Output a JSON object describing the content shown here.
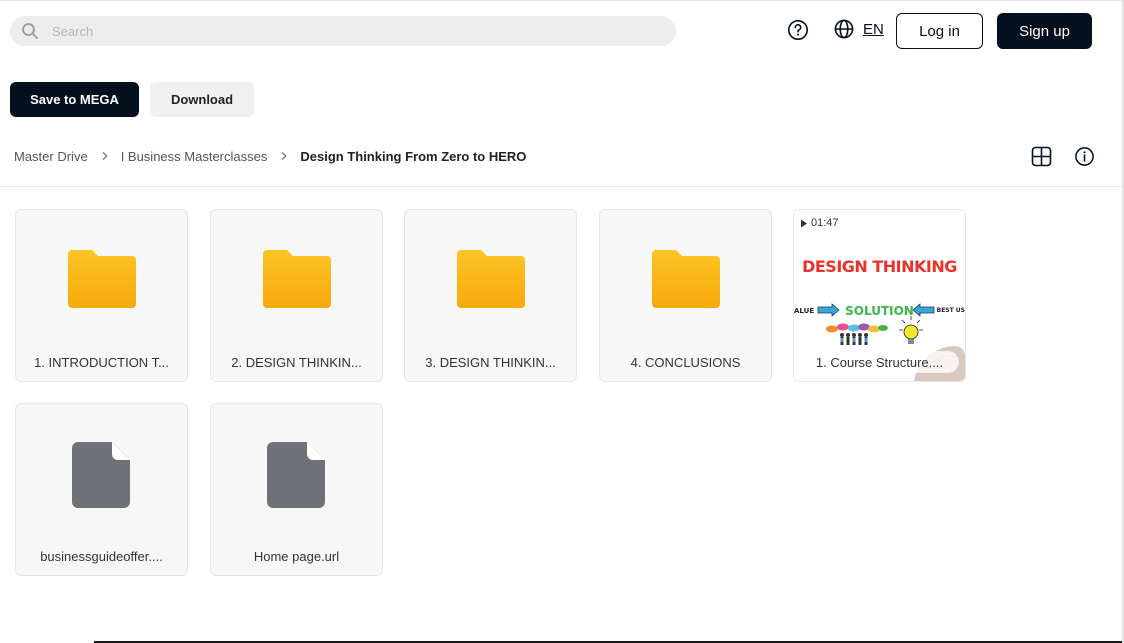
{
  "header": {
    "search_placeholder": "Search",
    "language": "EN",
    "login_label": "Log in",
    "signup_label": "Sign up"
  },
  "actions": {
    "save_label": "Save to MEGA",
    "download_label": "Download"
  },
  "breadcrumb": [
    {
      "label": "Master Drive"
    },
    {
      "label": "I Business Masterclasses"
    },
    {
      "label": "Design Thinking From Zero to HERO"
    }
  ],
  "items": [
    {
      "type": "folder",
      "label": "1. INTRODUCTION T..."
    },
    {
      "type": "folder",
      "label": "2. DESIGN THINKIN..."
    },
    {
      "type": "folder",
      "label": "3. DESIGN THINKIN..."
    },
    {
      "type": "folder",
      "label": "4. CONCLUSIONS"
    },
    {
      "type": "video",
      "label": "1. Course Structure....",
      "duration": "01:47",
      "thumbnail": {
        "title": "DESIGN THINKING",
        "center": "SOLUTION",
        "left": "ALUE",
        "right": "BEST US"
      }
    },
    {
      "type": "file",
      "label": "businessguideoffer...."
    },
    {
      "type": "file",
      "label": "Home page.url"
    }
  ],
  "colors": {
    "primary_dark": "#04101e",
    "folder_yellow": "#f9b40f",
    "file_gray": "#6f7278",
    "card_bg": "#f7f7f7"
  }
}
